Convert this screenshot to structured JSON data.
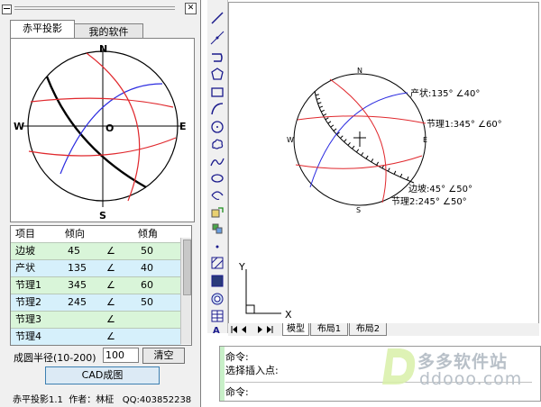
{
  "panel": {
    "close_glyph": "✕",
    "tabs": [
      "赤平投影",
      "我的软件"
    ],
    "directions": {
      "n": "N",
      "s": "S",
      "e": "E",
      "w": "W",
      "center": "O"
    },
    "table": {
      "headers": [
        "项目",
        "倾向",
        "",
        "倾角"
      ],
      "rows": [
        {
          "name": "边坡",
          "dir": "45",
          "sym": "∠",
          "dip": "50",
          "color": "#d9f5d9"
        },
        {
          "name": "产状",
          "dir": "135",
          "sym": "∠",
          "dip": "40",
          "color": "#d6f0fb"
        },
        {
          "name": "节理1",
          "dir": "345",
          "sym": "∠",
          "dip": "60",
          "color": "#d9f5d9"
        },
        {
          "name": "节理2",
          "dir": "245",
          "sym": "∠",
          "dip": "50",
          "color": "#d6f0fb"
        },
        {
          "name": "节理3",
          "dir": "",
          "sym": "∠",
          "dip": "",
          "color": "#d9f5d9"
        },
        {
          "name": "节理4",
          "dir": "",
          "sym": "∠",
          "dip": "",
          "color": "#d6f0fb"
        }
      ]
    },
    "radius_label": "成圆半径(10-200)",
    "radius_value": "100",
    "clear_button": "清空",
    "cad_button": "CAD成图",
    "footer": "赤平投影1.1  作者：林柾   QQ:403852238"
  },
  "drawing": {
    "directions": {
      "n": "N",
      "s": "S",
      "e": "E",
      "w": "W"
    },
    "labels": {
      "chanzhuang": "产状:135° ∠40°",
      "jieli1": "节理1:345° ∠60°",
      "bianpo": "边坡:45° ∠50°",
      "jieli2": "节理2:245° ∠50°"
    },
    "axis_y": "Y",
    "axis_x": "X",
    "layout_tabs": [
      "模型",
      "布局1",
      "布局2"
    ]
  },
  "command": {
    "line1": "命令:",
    "line2": "选择插入点:",
    "line3": "命令:"
  },
  "watermark": {
    "name": "多多软件站",
    "url": "ddooo.com"
  },
  "colors": {
    "red": "#e0282d",
    "blue": "#2b2be0",
    "black": "#000000",
    "accent_green": "#c8f0c8"
  }
}
